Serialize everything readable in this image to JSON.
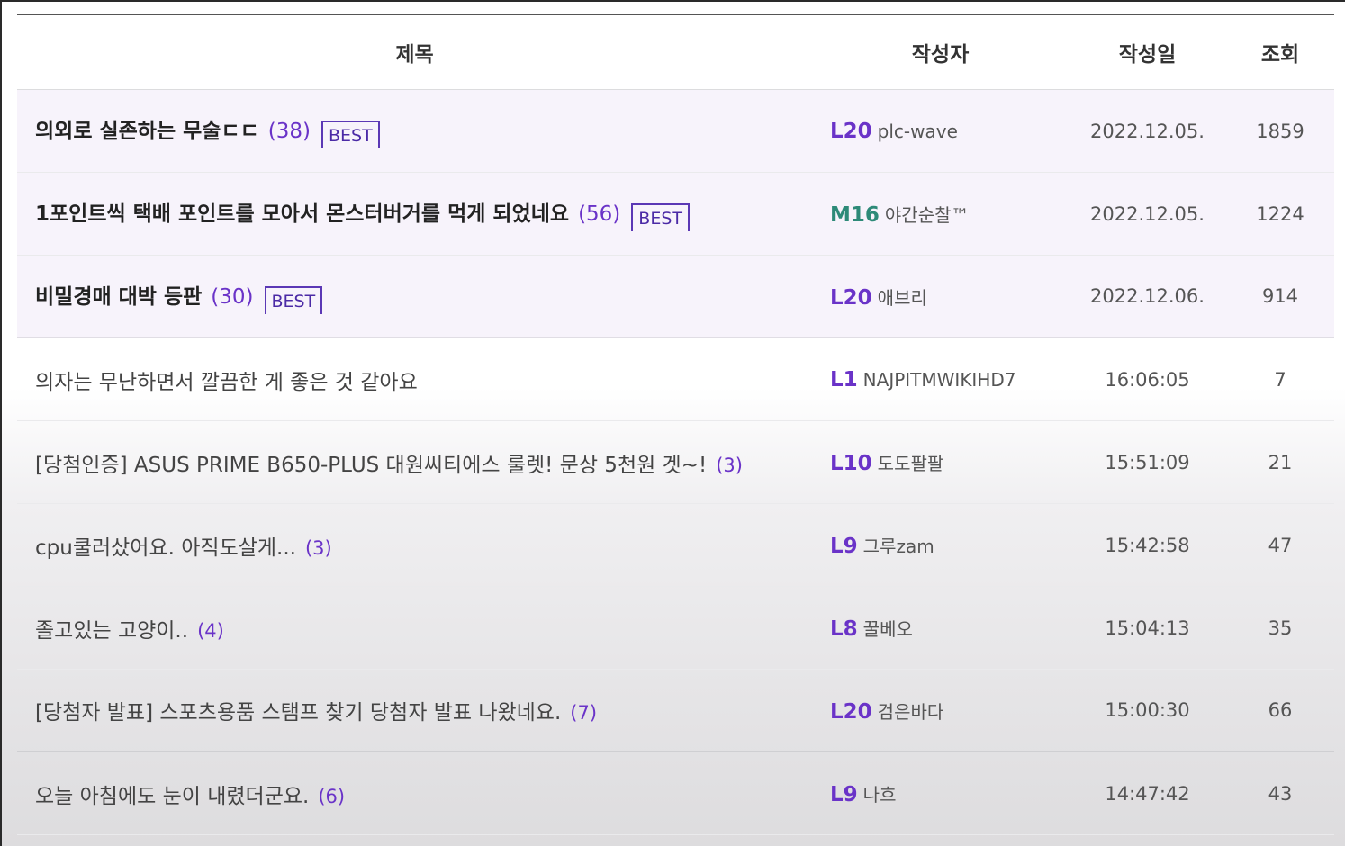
{
  "headers": {
    "title": "제목",
    "author": "작성자",
    "date": "작성일",
    "views": "조회"
  },
  "posts": [
    {
      "title": "의외로 실존하는 무술ㄷㄷ",
      "comments": "(38)",
      "badge": "BEST",
      "level": "L20",
      "author": "plc-wave",
      "date": "2022.12.05.",
      "views": "1859"
    },
    {
      "title": "1포인트씩 택배 포인트를 모아서 몬스터버거를 먹게 되었네요",
      "comments": "(56)",
      "badge": "BEST",
      "level": "M16",
      "author": "야간순찰™",
      "date": "2022.12.05.",
      "views": "1224"
    },
    {
      "title": "비밀경매 대박 등판",
      "comments": "(30)",
      "badge": "BEST",
      "level": "L20",
      "author": "애브리",
      "date": "2022.12.06.",
      "views": "914"
    },
    {
      "title": "의자는 무난하면서 깔끔한 게 좋은 것 같아요",
      "comments": "",
      "badge": "",
      "level": "L1",
      "author": "NAJPITMWIKIHD7",
      "date": "16:06:05",
      "views": "7"
    },
    {
      "title": "[당첨인증] ASUS PRIME B650-PLUS 대원씨티에스 룰렛! 문상 5천원 겟~!",
      "comments": "(3)",
      "badge": "",
      "level": "L10",
      "author": "도도팔팔",
      "date": "15:51:09",
      "views": "21"
    },
    {
      "title": "cpu쿨러샀어요. 아직도살게...",
      "comments": "(3)",
      "badge": "",
      "level": "L9",
      "author": "그루zam",
      "date": "15:42:58",
      "views": "47"
    },
    {
      "title": "졸고있는 고양이..",
      "comments": "(4)",
      "badge": "",
      "level": "L8",
      "author": "꿀베오",
      "date": "15:04:13",
      "views": "35"
    },
    {
      "title": "[당첨자 발표] 스포츠용품 스탬프 찾기 당첨자 발표 나왔네요.",
      "comments": "(7)",
      "badge": "",
      "level": "L20",
      "author": "검은바다",
      "date": "15:00:30",
      "views": "66"
    },
    {
      "title": "오늘 아침에도 눈이 내렸더군요.",
      "comments": "(6)",
      "badge": "",
      "level": "L9",
      "author": "나흐",
      "date": "14:47:42",
      "views": "43"
    }
  ]
}
